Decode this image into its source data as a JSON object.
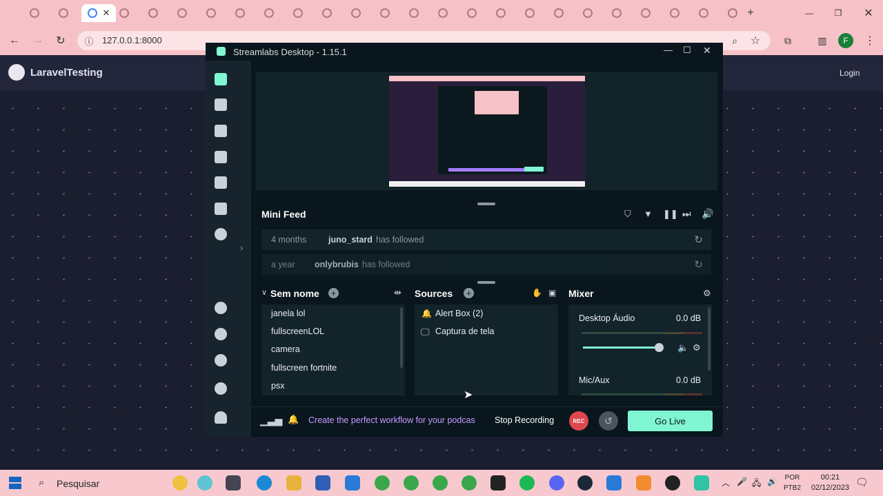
{
  "browser": {
    "address": "127.0.0.1:8000",
    "profile_initial": "F"
  },
  "site": {
    "title": "LaravelTesting",
    "login": "Login"
  },
  "streamlabs": {
    "title": "Streamlabs Desktop - 1.15.1",
    "mini_feed": {
      "title": "Mini Feed",
      "events": [
        {
          "time": "4 months",
          "user": "juno_stard",
          "action": "has followed"
        },
        {
          "time": "a year",
          "user": "onlybrubis",
          "action": "has followed"
        }
      ]
    },
    "scenes": {
      "title": "Sem nome",
      "items": [
        "janela lol",
        "fullscreenLOL",
        "camera",
        "fullscreen fortnite",
        "psx"
      ]
    },
    "sources": {
      "title": "Sources",
      "items": [
        "Alert Box (2)",
        "Captura de tela"
      ]
    },
    "mixer": {
      "title": "Mixer",
      "channels": [
        {
          "name": "Desktop Áudio",
          "level": "0.0 dB"
        },
        {
          "name": "Mic/Aux",
          "level": "0.0 dB"
        }
      ]
    },
    "bottom": {
      "banner": "Create the perfect workflow for your podcas",
      "stop_recording": "Stop Recording",
      "rec": "REC",
      "go_live": "Go Live"
    }
  },
  "taskbar": {
    "search": "Pesquisar",
    "lang_top": "POR",
    "lang_bottom": "PTB2",
    "time": "00:21",
    "date": "02/12/2023"
  },
  "colors": {
    "accent": "#80f5d2",
    "rec": "#e0464d",
    "tabstrip": "#f7c1c8"
  }
}
